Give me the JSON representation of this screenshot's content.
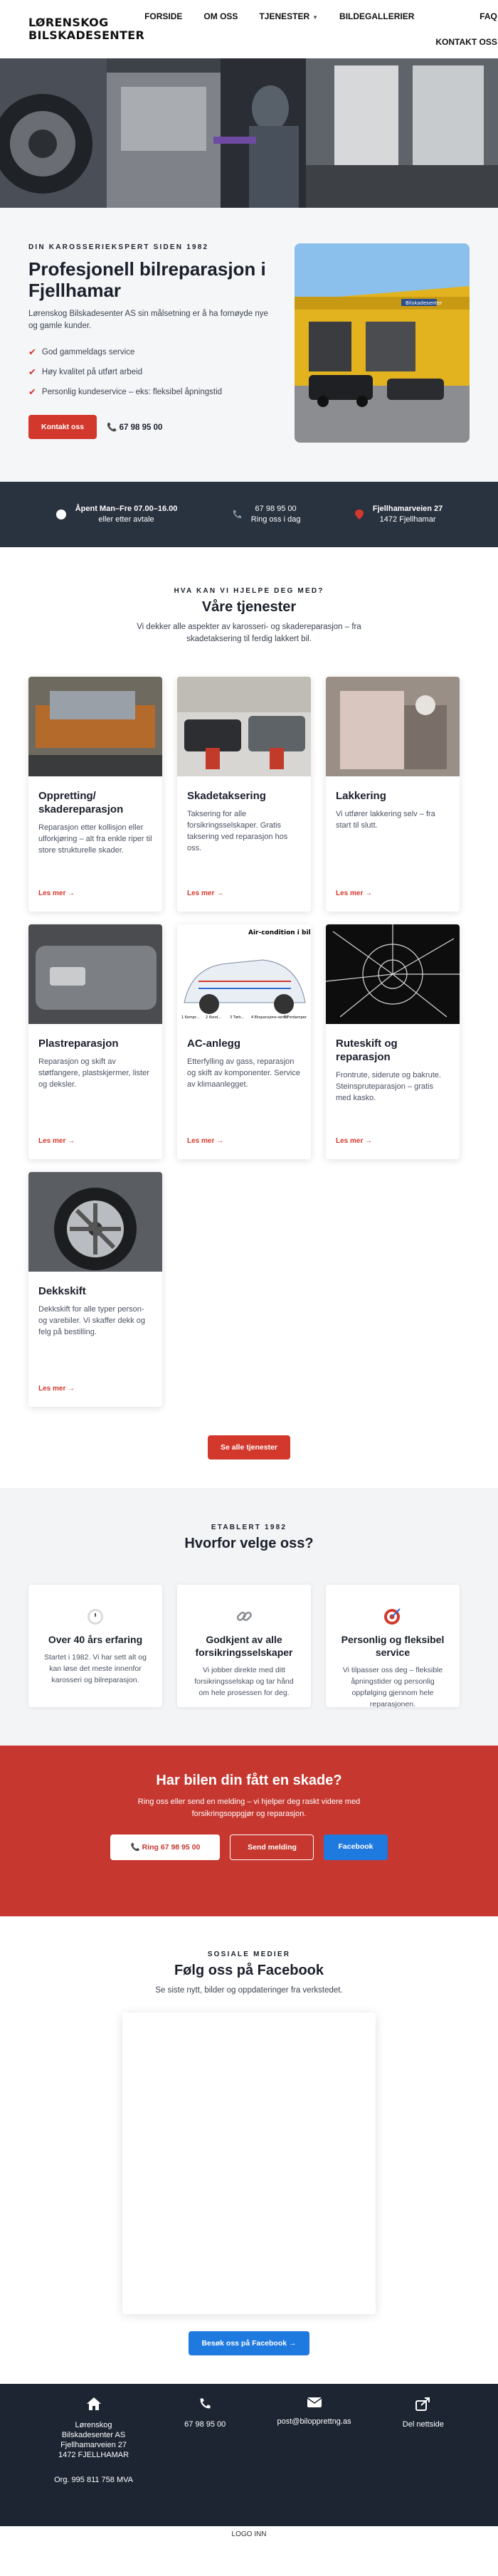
{
  "header": {
    "logo_line1": "LØRENSKOG",
    "logo_line2": "BILSKADESENTER",
    "nav": {
      "forside": "FORSIDE",
      "om_oss": "OM OSS",
      "tjenester": "TJENESTER",
      "bildegalleri": "BILDEGALLERIER",
      "faq": "FAQ",
      "kontakt": "KONTAKT OSS"
    }
  },
  "intro": {
    "eyebrow": "DIN KAROSSERIEKSPERT SIDEN 1982",
    "title": "Profesjonell bilreparasjon i Fjellhamar",
    "text": "Lørenskog Bilskadesenter AS sin målsetning er å ha fornøyde nye og gamle kunder.",
    "checks": [
      "God gammeldags service",
      "Høy kvalitet på utført arbeid",
      "Personlig kundeservice – eks: fleksibel åpningstid"
    ],
    "cta": "Kontakt oss",
    "phone": "67 98 95 00",
    "garage_sign": "Bilskadesenter"
  },
  "info": {
    "hours1": "Åpent Man–Fre 07.00–16.00",
    "hours2": "eller etter avtale",
    "phone1": "67 98 95 00",
    "phone2": "Ring oss i dag",
    "addr1": "Fjellhamarveien 27",
    "addr2": "1472 Fjellhamar"
  },
  "services": {
    "eyebrow": "HVA KAN VI HJELPE DEG MED?",
    "title": "Våre tjenester",
    "lead": "Vi dekker alle aspekter av karosseri- og skadereparasjon – fra skadetaksering til ferdig lakkert bil.",
    "more": "Les mer →",
    "all": "Se alle tjenester",
    "cards": [
      {
        "title": "Oppretting/ skadereparasjon",
        "text": "Reparasjon etter kollisjon eller ulforkjøring – alt fra enkle riper til store strukturelle skader."
      },
      {
        "title": "Skadetaksering",
        "text": "Taksering for alle forsikringsselskaper. Gratis taksering ved reparasjon hos oss."
      },
      {
        "title": "Lakkering",
        "text": "Vi utfører lakkering selv – fra start til slutt."
      },
      {
        "title": "Plastreparasjon",
        "text": "Reparasjon og skift av støtfangere, plastskjermer, lister og deksler."
      },
      {
        "title": "AC-anlegg",
        "text": "Etterfylling av gass, reparasjon og skift av komponenter. Service av klimaanlegget."
      },
      {
        "title": "Ruteskift og reparasjon",
        "text": "Frontrute, siderute og bakrute. Steinspruteparasjon – gratis med kasko."
      },
      {
        "title": "Dekkskift",
        "text": "Dekkskift for alle typer person- og varebiler. Vi skaffer dekk og felg på bestilling."
      }
    ],
    "ac_diagram": {
      "title": "Air-condition i bil",
      "labels": [
        "1 Kompr...",
        "2 Kond...",
        "3 Tørk...",
        "4 Ekspansjons-ventil",
        "5 Fordamper"
      ]
    }
  },
  "why": {
    "eyebrow": "ETABLERT 1982",
    "title": "Hvorfor velge oss?",
    "cards": [
      {
        "title": "Over 40 års erfaring",
        "text": "Startet i 1982. Vi har sett alt og kan løse det meste innenfor karosseri og bilreparasjon."
      },
      {
        "title": "Godkjent av alle forsikringsselskaper",
        "text": "Vi jobber direkte med ditt forsikringsselskap og tar hånd om hele prosessen for deg."
      },
      {
        "title": "Personlig og fleksibel service",
        "text": "Vi tilpasser oss deg – fleksible åpningstider og personlig oppfølging gjennom hele reparasjonen."
      }
    ]
  },
  "cta": {
    "title": "Har bilen din fått en skade?",
    "text": "Ring oss eller send en melding – vi hjelper deg raskt videre med forsikringsoppgjør og reparasjon.",
    "call": "📞 Ring 67 98 95 00",
    "msg": "Send melding",
    "fb": "Facebook"
  },
  "fb": {
    "eyebrow": "SOSIALE MEDIER",
    "title": "Følg oss på Facebook",
    "lead": "Se siste nytt, bilder og oppdateringer fra verkstedet.",
    "btn": "Besøk oss på Facebook →"
  },
  "footer": {
    "addr": [
      "Lørenskog",
      "Bilskadesenter AS",
      "Fjellhamarveien 27",
      "1472 FJELLHAMAR"
    ],
    "org": "Org. 995 811 758 MVA",
    "phone": "67 98 95 00",
    "email": "post@bilopprettng.as",
    "share": "Del nettside"
  },
  "logo_inn": "LOGO INN",
  "colors": {
    "accent": "#d3382d",
    "dark": "#29323f",
    "blue": "#1f7ae0"
  }
}
